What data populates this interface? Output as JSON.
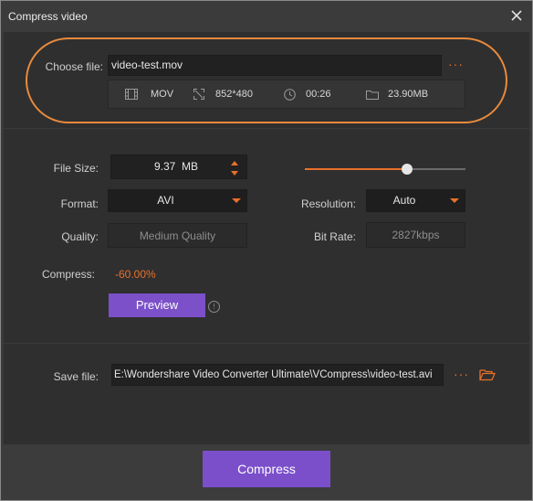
{
  "window": {
    "title": "Compress video"
  },
  "choose_file": {
    "label": "Choose file:",
    "value": "video-test.mov",
    "more_label": "···"
  },
  "file_info": {
    "format": "MOV",
    "resolution": "852*480",
    "duration": "00:26",
    "size": "23.90MB"
  },
  "settings": {
    "file_size_label": "File Size:",
    "file_size_value": "9.37",
    "file_size_unit": "MB",
    "format_label": "Format:",
    "format_value": "AVI",
    "resolution_label": "Resolution:",
    "resolution_value": "Auto",
    "quality_label": "Quality:",
    "quality_value": "Medium Quality",
    "bitrate_label": "Bit Rate:",
    "bitrate_value": "2827kbps",
    "compress_label": "Compress:",
    "compress_value": "-60.00%"
  },
  "preview_button": {
    "label": "Preview"
  },
  "info_icon": {
    "glyph": "!"
  },
  "save_file": {
    "label": "Save file:",
    "value": "E:\\Wondershare Video Converter Ultimate\\VCompress\\video-test.avi",
    "more_label": "···"
  },
  "compress_button": {
    "label": "Compress"
  },
  "colors": {
    "accent": "#e8702a",
    "button_purple": "#7b50c9",
    "background": "#2f2f2f",
    "field_bg": "#212121",
    "highlight_ring": "#e88a3c"
  },
  "icons": [
    "close-icon",
    "film-icon",
    "resolution-icon",
    "clock-icon",
    "folder-icon",
    "spinner-icon",
    "dropdown-arrow-icon",
    "info-icon",
    "folder-open-icon"
  ]
}
